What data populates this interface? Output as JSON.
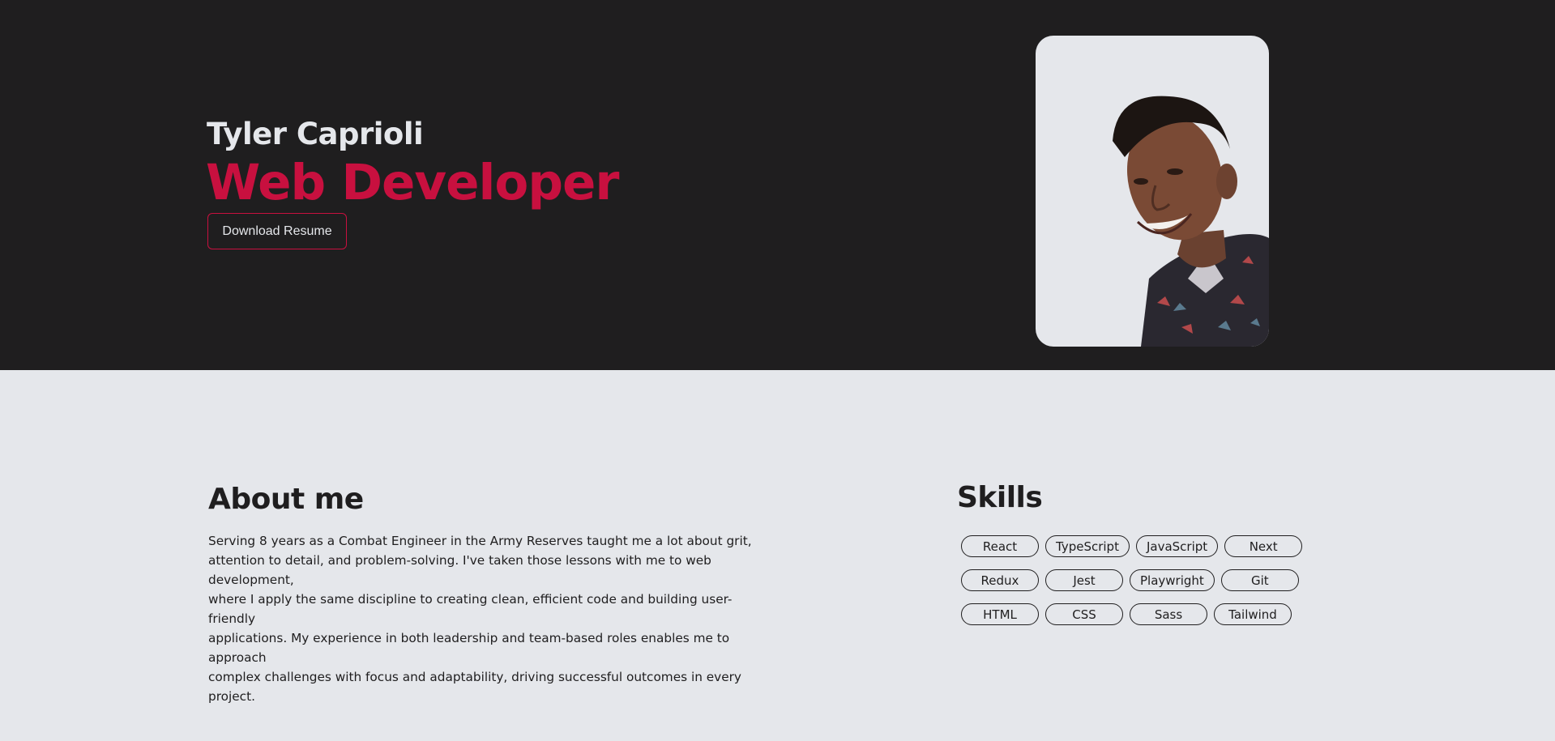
{
  "hero": {
    "name": "Tyler Caprioli",
    "role": "Web Developer",
    "resume_button": "Download Resume",
    "photo_alt": "portrait-photo"
  },
  "about": {
    "title": "About me",
    "lines": [
      "Serving 8 years as a Combat Engineer in the Army Reserves taught me a lot about grit,",
      "attention to detail, and problem-solving. I've taken those lessons with me to web development,",
      "where I apply the same discipline to creating clean, efficient code and building user-friendly",
      "applications. My experience in both leadership and team-based roles enables me to approach",
      "complex challenges with focus and adaptability, driving successful outcomes in every project."
    ]
  },
  "skills": {
    "title": "Skills",
    "rows": [
      [
        "React",
        "TypeScript",
        "JavaScript",
        "Next"
      ],
      [
        "Redux",
        "Jest",
        "Playwright",
        "Git"
      ],
      [
        "HTML",
        "CSS",
        "Sass",
        "Tailwind"
      ]
    ]
  },
  "colors": {
    "dark_bg": "#1f1e1f",
    "light_bg": "#e5e7eb",
    "accent": "#c8103f"
  }
}
